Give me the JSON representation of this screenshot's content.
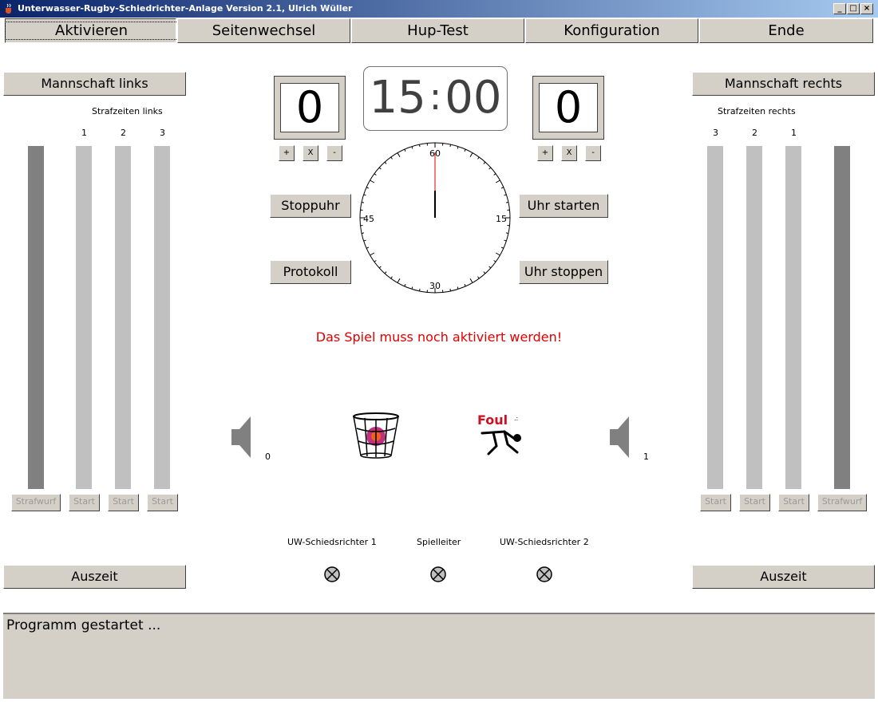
{
  "window": {
    "title": "Unterwasser-Rugby-Schiedrichter-Anlage Version 2.1, Ulrich Wüller"
  },
  "menu": {
    "aktivieren": "Aktivieren",
    "seitenwechsel": "Seitenwechsel",
    "huptest": "Hup-Test",
    "konfiguration": "Konfiguration",
    "ende": "Ende"
  },
  "left": {
    "team": "Mannschaft links",
    "penalty_title": "Strafzeiten links",
    "col1": "1",
    "col2": "2",
    "col3": "3",
    "strafwurf": "Strafwurf",
    "start": "Start",
    "auszeit": "Auszeit",
    "horn_count": "0"
  },
  "right": {
    "team": "Mannschaft rechts",
    "penalty_title": "Strafzeiten rechts",
    "col1": "3",
    "col2": "2",
    "col3": "1",
    "strafwurf": "Strafwurf",
    "start": "Start",
    "auszeit": "Auszeit",
    "horn_count": "1"
  },
  "score": {
    "left": "0",
    "right": "0",
    "plus": "+",
    "reset": "X",
    "minus": "-"
  },
  "clock": {
    "minutes": "15",
    "sep": ":",
    "seconds": "00"
  },
  "dial": {
    "n": "60",
    "e": "15",
    "s": "30",
    "w": "45"
  },
  "buttons": {
    "stoppuhr": "Stoppuhr",
    "protokoll": "Protokoll",
    "uhr_starten": "Uhr starten",
    "uhr_stoppen": "Uhr stoppen"
  },
  "message": "Das Spiel muss noch aktiviert werden!",
  "foul_label": "Foul",
  "referees": {
    "r1": "UW-Schiedsrichter 1",
    "lead": "Spielleiter",
    "r2": "UW-Schiedsrichter 2"
  },
  "status": "Programm gestartet ...",
  "colors": {
    "message": "#e00000",
    "titlebar": "#0a246a",
    "face": "#d4d0c8"
  }
}
